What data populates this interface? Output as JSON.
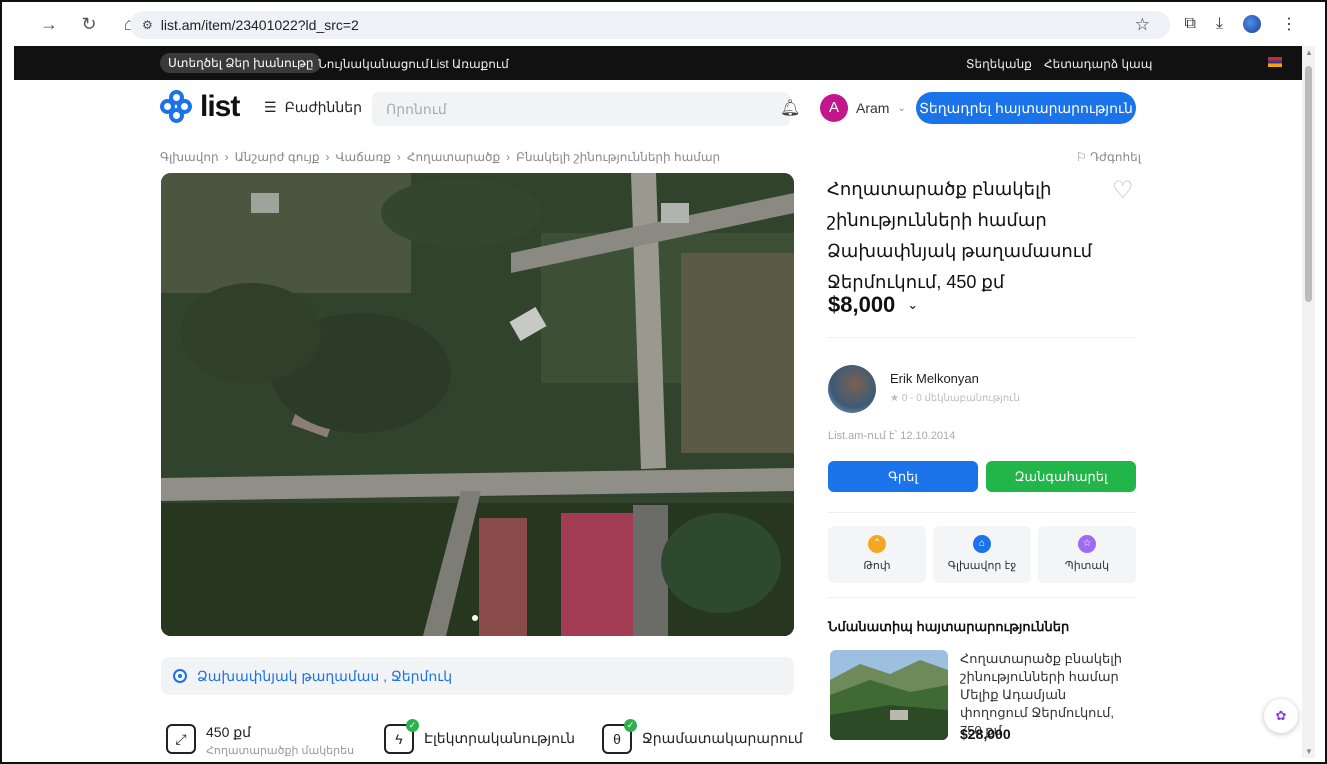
{
  "browser": {
    "url": "list.am/item/23401022?ld_src=2",
    "nav_icons": [
      "back-arrow-icon",
      "reload-icon",
      "home-icon"
    ],
    "right_icons": [
      "bookmark-star-icon",
      "extensions-icon",
      "download-icon",
      "profile-icon",
      "menu-icon"
    ]
  },
  "topbar": {
    "create_store": "Ստեղծել Ձեր խանութը",
    "news": "Նույնականացում",
    "list_store": "List Առաքում",
    "help": "Տեղեկանք",
    "feedback": "Հետադարձ կապ"
  },
  "header": {
    "logo": "list",
    "categories": "Բաժիններ",
    "search_placeholder": "Որոնում",
    "user_initial": "A",
    "user_name": "Aram",
    "post_ad": "Տեղադրել հայտարարություն"
  },
  "breadcrumb": [
    "Գլխավոր",
    "Անշարժ գույք",
    "Վաճառք",
    "Հողատարածք",
    "Բնակելի շինությունների համար"
  ],
  "report": "Դժգոհել",
  "listing": {
    "title": "Հողատարածք բնակելի շինությունների համար Ձախափնյակ թաղամասում Ջերմուկում, 450 քմ",
    "price": "$8,000",
    "location": "Ձախափնյակ թաղամաս , Ջերմուկ",
    "features": [
      {
        "label": "450 քմ",
        "sub": "Հողատարածքի մակերես",
        "icon": "area-expand-icon"
      },
      {
        "label": "Էլեկտրականություն",
        "icon": "electricity-icon"
      },
      {
        "label": "Ջրամատակարարում",
        "icon": "water-supply-icon"
      }
    ]
  },
  "seller": {
    "name": "Erik Melkonyan",
    "rating": "0 - 0 մեկնաբանություն",
    "since": "List.am-ում է՝ 12.10.2014",
    "write": "Գրել",
    "call": "Զանգահարել"
  },
  "promotions": [
    {
      "label": "Թոփ",
      "color": "#f5a623",
      "icon": "top-chevrons-icon"
    },
    {
      "label": "Գլխավոր էջ",
      "color": "#1a73e8",
      "icon": "home-page-icon"
    },
    {
      "label": "Պիտակ",
      "color": "#9b6cf0",
      "icon": "label-star-icon"
    }
  ],
  "similar": {
    "heading": "Նմանատիպ հայտարարություններ",
    "items": [
      {
        "title": "Հողատարածք բնակելի շինությունների համար Մելիք Ադամյան փողոցում Ջերմուկում, 750 քմ",
        "price": "$28,000"
      }
    ]
  }
}
